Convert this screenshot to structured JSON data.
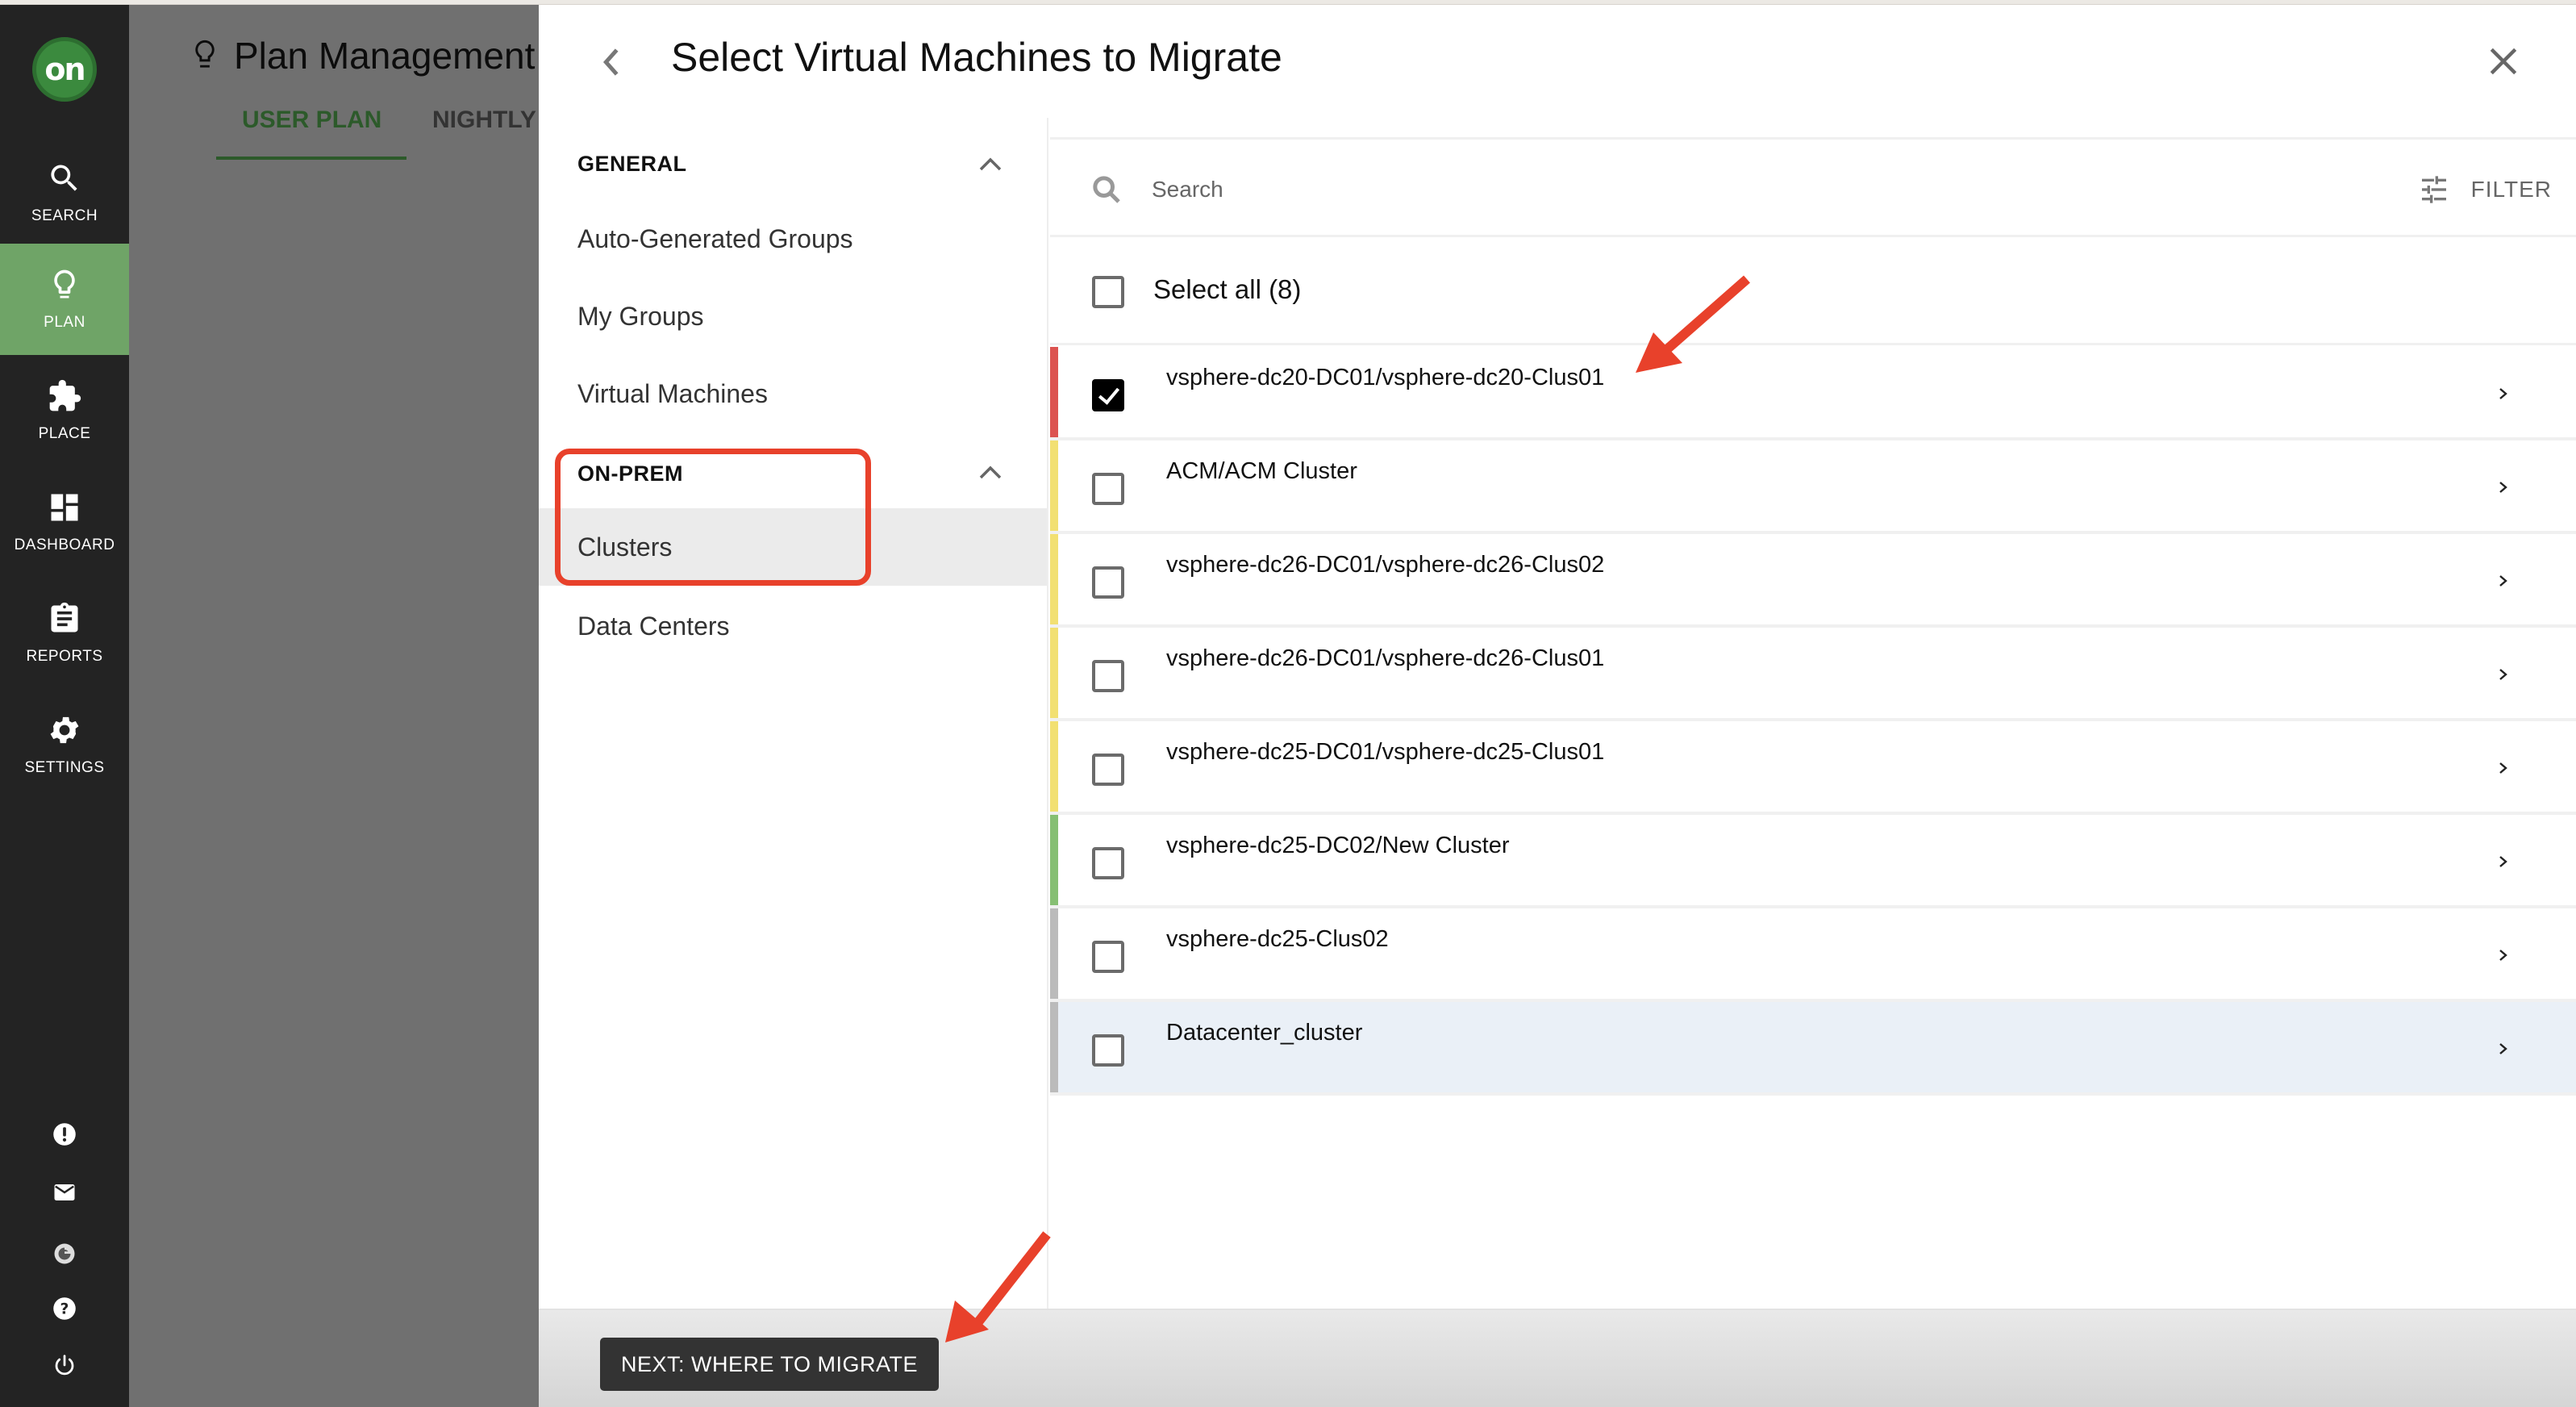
{
  "nav": {
    "logo_text": "on",
    "items": [
      {
        "label": "SEARCH",
        "icon": "search-icon",
        "active": false
      },
      {
        "label": "PLAN",
        "icon": "lightbulb-icon",
        "active": true
      },
      {
        "label": "PLACE",
        "icon": "puzzle-icon",
        "active": false
      },
      {
        "label": "DASHBOARD",
        "icon": "dashboard-icon",
        "active": false
      },
      {
        "label": "REPORTS",
        "icon": "clipboard-icon",
        "active": false
      },
      {
        "label": "SETTINGS",
        "icon": "gear-icon",
        "active": false
      }
    ],
    "bottom_icons": [
      "alert-icon",
      "mail-icon",
      "g-icon",
      "help-icon",
      "power-icon"
    ],
    "active_color": "#6fa467"
  },
  "background_page": {
    "title": "Plan Management",
    "tabs": [
      {
        "label": "USER PLAN",
        "active": true
      },
      {
        "label": "NIGHTLY",
        "active": false
      }
    ]
  },
  "modal": {
    "title": "Select Virtual Machines to Migrate",
    "categories": [
      {
        "heading": "GENERAL",
        "expanded": true,
        "items": [
          {
            "label": "Auto-Generated Groups",
            "selected": false
          },
          {
            "label": "My Groups",
            "selected": false
          },
          {
            "label": "Virtual Machines",
            "selected": false
          }
        ]
      },
      {
        "heading": "ON-PREM",
        "expanded": true,
        "items": [
          {
            "label": "Clusters",
            "selected": true
          },
          {
            "label": "Data Centers",
            "selected": false
          }
        ]
      }
    ],
    "search": {
      "placeholder": "Search",
      "value": ""
    },
    "filter_label": "FILTER",
    "select_all_label": "Select all (8)",
    "select_all_checked": false,
    "rows": [
      {
        "name": "vsphere-dc20-DC01/vsphere-dc20-Clus01",
        "checked": true,
        "severity": "critical",
        "severity_color": "#dc5350"
      },
      {
        "name": "ACM/ACM Cluster",
        "checked": false,
        "severity": "minor",
        "severity_color": "#f2e072"
      },
      {
        "name": "vsphere-dc26-DC01/vsphere-dc26-Clus02",
        "checked": false,
        "severity": "minor",
        "severity_color": "#f2e072"
      },
      {
        "name": "vsphere-dc26-DC01/vsphere-dc26-Clus01",
        "checked": false,
        "severity": "minor",
        "severity_color": "#f2e072"
      },
      {
        "name": "vsphere-dc25-DC01/vsphere-dc25-Clus01",
        "checked": false,
        "severity": "minor",
        "severity_color": "#f2e072"
      },
      {
        "name": "vsphere-dc25-DC02/New Cluster",
        "checked": false,
        "severity": "normal",
        "severity_color": "#86bf73"
      },
      {
        "name": "vsphere-dc25-Clus02",
        "checked": false,
        "severity": "unknown",
        "severity_color": "#bbbbbb"
      },
      {
        "name": "Datacenter_cluster",
        "checked": false,
        "severity": "unknown",
        "severity_color": "#bbbbbb",
        "hovered": true
      }
    ],
    "next_button_label": "NEXT: WHERE TO MIGRATE"
  },
  "annotation_color": "#e8412b"
}
